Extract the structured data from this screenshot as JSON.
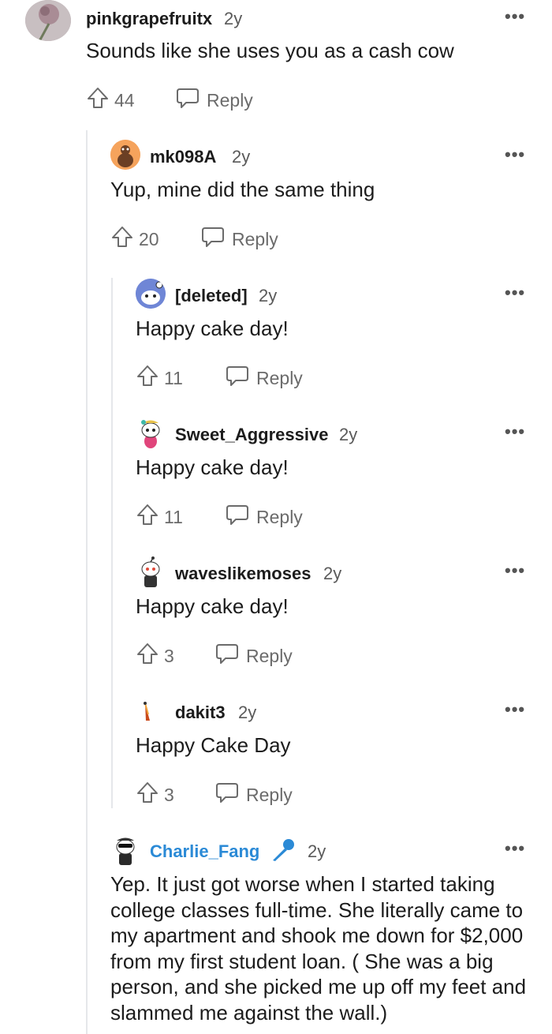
{
  "comments": [
    {
      "username": "pinkgrapefruitx",
      "age": "2y",
      "body": "Sounds like she uses you as a cash cow",
      "votes": "44",
      "reply": "Reply",
      "more": "•••"
    },
    {
      "username": "mk098A",
      "age": "2y",
      "body": "Yup, mine did the same thing",
      "votes": "20",
      "reply": "Reply",
      "more": "•••"
    },
    {
      "username": "[deleted]",
      "age": "2y",
      "body": "Happy cake day!",
      "votes": "11",
      "reply": "Reply",
      "more": "•••"
    },
    {
      "username": "Sweet_Aggressive",
      "age": "2y",
      "body": "Happy cake day!",
      "votes": "11",
      "reply": "Reply",
      "more": "•••"
    },
    {
      "username": "waveslikemoses",
      "age": "2y",
      "body": "Happy cake day!",
      "votes": "3",
      "reply": "Reply",
      "more": "•••"
    },
    {
      "username": "dakit3",
      "age": "2y",
      "body": "Happy Cake Day",
      "votes": "3",
      "reply": "Reply",
      "more": "•••"
    },
    {
      "username": "Charlie_Fang",
      "age": "2y",
      "body": "Yep. It just got worse when I started taking college classes full-time. She literally came to my apartment and shook me down for $2,000 from my first student loan. ( She was a big person, and she picked me up off my feet and slammed me against the wall.)",
      "more": "•••"
    }
  ],
  "colors": {
    "op_username": "#2b8ad6",
    "text": "#1c1c1c",
    "muted": "#6b6b6b",
    "thread_line": "#e5e7ea"
  },
  "icons": {
    "upvote": "upvote-icon",
    "reply": "reply-icon",
    "more": "more-options-icon",
    "op_badge": "microphone-icon"
  }
}
